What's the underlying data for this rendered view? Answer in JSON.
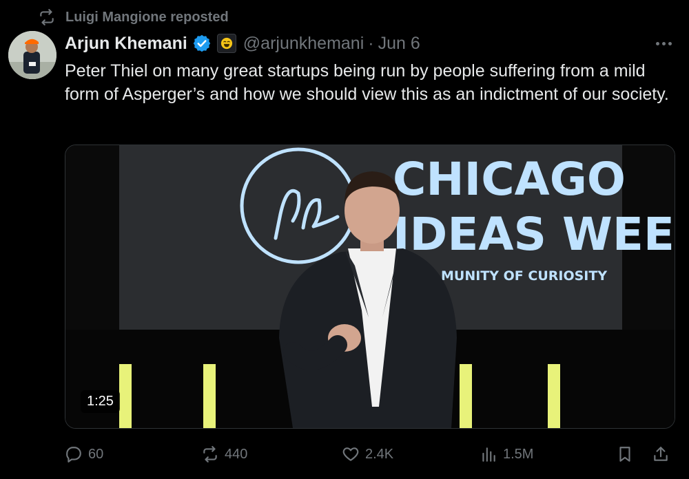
{
  "repost_banner": {
    "text": "Luigi Mangione reposted",
    "icon": "repost-icon"
  },
  "tweet": {
    "author_name": "Arjun Khemani",
    "verified": true,
    "affiliation_badge": "laughing-emoji-badge",
    "handle": "@arjunkhemani",
    "separator": "·",
    "date": "Jun 6",
    "text": "Peter Thiel on many great startups being run by people suffering from a mild form of Asperger’s and how we should view this as an indictment of our society."
  },
  "video": {
    "duration": "1:25",
    "backdrop": {
      "line1": "CHICAGO",
      "line2": "IDEAS WEE",
      "line3": "MUNITY OF CURIOSITY"
    }
  },
  "actions": {
    "replies": "60",
    "reposts": "440",
    "likes": "2.4K",
    "views": "1.5M"
  },
  "colors": {
    "background": "#000000",
    "text": "#e7e9ea",
    "muted": "#71767b",
    "verified": "#1d9bf0",
    "stage_text": "#bfe2ff"
  }
}
